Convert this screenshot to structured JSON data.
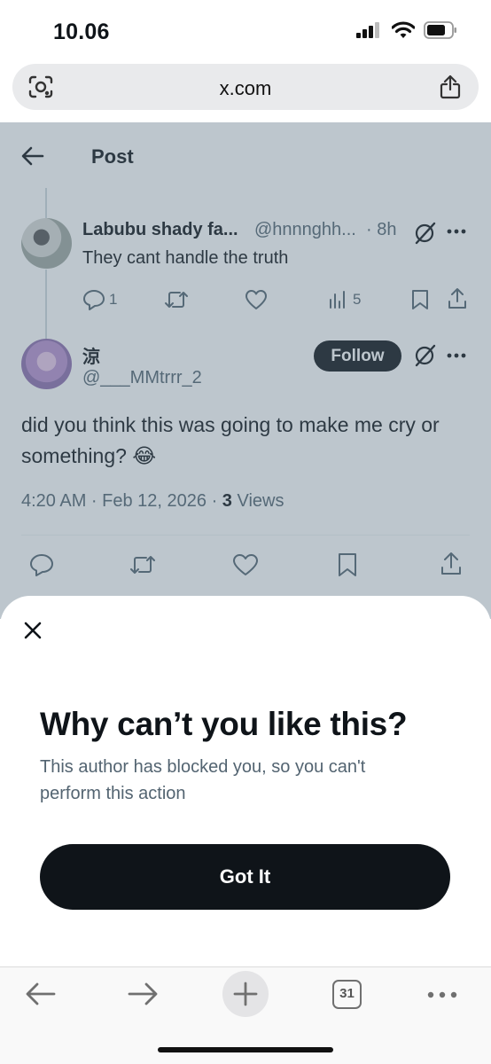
{
  "status_bar": {
    "time": "10.06"
  },
  "browser": {
    "url": "x.com",
    "tab_count": "31"
  },
  "post_header": {
    "title": "Post"
  },
  "parent_tweet": {
    "name": "Labubu shady fa...",
    "handle": "@hnnnghh...",
    "time": "· 8h",
    "text": "They cant handle the truth",
    "replies": "1",
    "views": "5"
  },
  "main_tweet": {
    "name": "涼",
    "handle": "@___MMtrrr_2",
    "follow_label": "Follow",
    "text": "did you think this was going to make me cry or something? 😂",
    "timestamp": "4:20 AM · Feb 12, 2026 · ",
    "views_count": "3",
    "views_label": " Views"
  },
  "sheet": {
    "title": "Why can’t you like this?",
    "body": "This author has blocked you, so you can't perform this action",
    "button_label": "Got It"
  },
  "colors": {
    "text": "#0f1419",
    "secondary": "#536471",
    "overlay": "rgba(91,112,131,0.4)"
  }
}
